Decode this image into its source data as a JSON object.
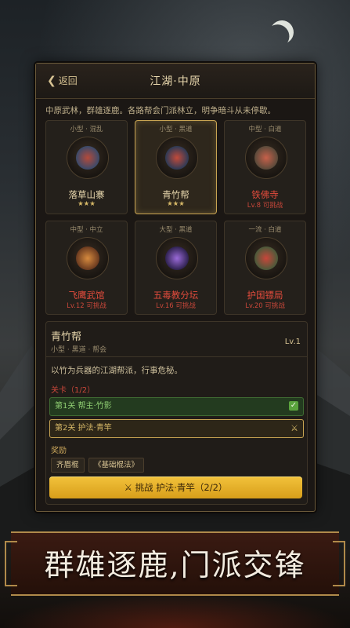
{
  "header": {
    "back_label": "返回",
    "title": "江湖·中原"
  },
  "description": "中原武林，群雄逐鹿。各路帮会门派林立，明争暗斗从未停歇。",
  "factions": [
    {
      "tag": "小型 · 混乱",
      "name": "落草山寨",
      "sub": "★★★",
      "locked": false,
      "selected": false
    },
    {
      "tag": "小型 · 黑道",
      "name": "青竹帮",
      "sub": "★★★",
      "locked": false,
      "selected": true
    },
    {
      "tag": "中型 · 白道",
      "name": "铁佛寺",
      "sub": "Lv.8 可挑战",
      "locked": true,
      "selected": false
    },
    {
      "tag": "中型 · 中立",
      "name": "飞鹰武馆",
      "sub": "Lv.12 可挑战",
      "locked": true,
      "selected": false
    },
    {
      "tag": "大型 · 黑道",
      "name": "五毒教分坛",
      "sub": "Lv.16 可挑战",
      "locked": true,
      "selected": false
    },
    {
      "tag": "一流 · 白道",
      "name": "护国镖局",
      "sub": "Lv.20 可挑战",
      "locked": true,
      "selected": false
    }
  ],
  "detail": {
    "name": "青竹帮",
    "level": "Lv.1",
    "tags": "小型 · 黑道 · 帮会",
    "description": "以竹为兵器的江湖帮派，行事危秘。",
    "stage_header": "关卡（1/2）",
    "stages": [
      {
        "label": "第1关 帮主·竹影",
        "status": "cleared"
      },
      {
        "label": "第2关 护法·青竿",
        "status": "current"
      }
    ],
    "reward_header": "奖励",
    "rewards": [
      "齐眉棍",
      "《基础棍法》"
    ],
    "challenge_button": "挑战 护法·青竿（2/2）"
  },
  "slogan": "群雄逐鹿,门派交锋",
  "colors": {
    "accent_gold": "#d89e1a",
    "locked_red": "#e24b3c",
    "cleared_green": "#8fce72"
  }
}
